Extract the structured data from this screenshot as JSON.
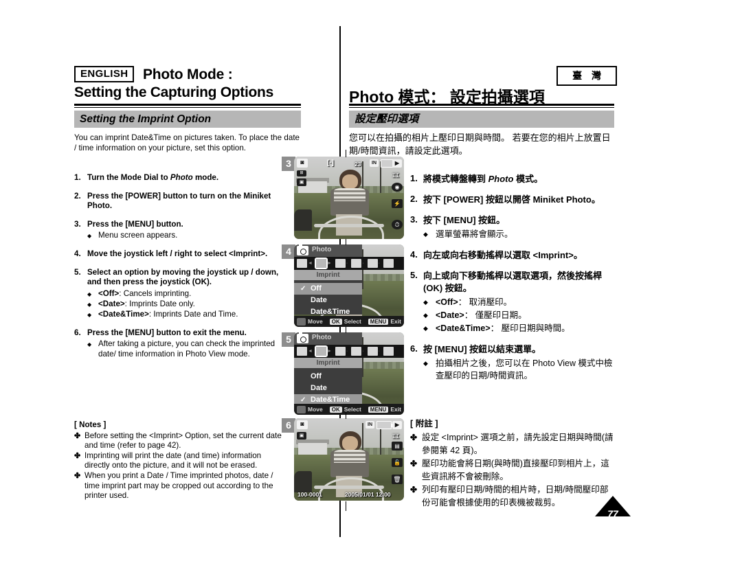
{
  "header": {
    "lang_badge": "ENGLISH",
    "title_line1": "Photo Mode :",
    "title_line2": "Setting the Capturing Options",
    "region_badge": "臺 灣",
    "title_zh": "Photo 模式： 設定拍攝選項"
  },
  "section": {
    "title_en": "Setting the Imprint Option",
    "title_zh": "設定壓印選項"
  },
  "intro": {
    "en": "You can imprint Date&Time on pictures taken. To place the date / time information on your picture, set this option.",
    "zh": "您可以在拍攝的相片上壓印日期與時間。 若要在您的相片上放置日期/時間資訊，請設定此選項。"
  },
  "steps_en": [
    {
      "num": "1.",
      "text_prefix": "Turn the Mode Dial to ",
      "text_italic": "Photo",
      "text_suffix": " mode.",
      "bullets": []
    },
    {
      "num": "2.",
      "text": "Press the [POWER] button to turn on the Miniket Photo.",
      "bullets": []
    },
    {
      "num": "3.",
      "text": "Press the [MENU] button.",
      "bullets": [
        {
          "mark": "◆",
          "text": "Menu screen appears."
        }
      ]
    },
    {
      "num": "4.",
      "text": "Move the joystick left / right to select <Imprint>.",
      "bullets": []
    },
    {
      "num": "5.",
      "text": "Select an option by moving the joystick up / down, and then press the joystick (OK).",
      "bullets": [
        {
          "mark": "◆",
          "bold": "<Off>",
          "text": ": Cancels imprinting."
        },
        {
          "mark": "◆",
          "bold": "<Date>",
          "text": ": Imprints Date only."
        },
        {
          "mark": "◆",
          "bold": "<Date&Time>",
          "text": ": Imprints Date and Time."
        }
      ]
    },
    {
      "num": "6.",
      "text": "Press the [MENU] button to exit the menu.",
      "bullets": [
        {
          "mark": "◆",
          "text": "After taking a picture, you can check the imprinted date/ time information in Photo View mode."
        }
      ]
    }
  ],
  "steps_zh": [
    {
      "num": "1.",
      "text_prefix": "將模式轉盤轉到 ",
      "text_italic": "Photo",
      "text_suffix": " 模式。",
      "bullets": []
    },
    {
      "num": "2.",
      "text": "按下 [POWER] 按鈕以開啓 Miniket Photo。",
      "bullets": []
    },
    {
      "num": "3.",
      "text": "按下 [MENU] 按鈕。",
      "bullets": [
        {
          "mark": "◆",
          "text": "選單螢幕將會顯示。"
        }
      ]
    },
    {
      "num": "4.",
      "text": "向左或向右移動搖桿以選取 <Imprint>。",
      "bullets": []
    },
    {
      "num": "5.",
      "text": "向上或向下移動搖桿以選取選項，然後按搖桿 (OK) 按鈕。",
      "bullets": [
        {
          "mark": "◆",
          "bold": "<Off>",
          "text": "： 取消壓印。"
        },
        {
          "mark": "◆",
          "bold": "<Date>",
          "text": "： 僅壓印日期。"
        },
        {
          "mark": "◆",
          "bold": "<Date&Time>",
          "text": "： 壓印日期與時間。"
        }
      ]
    },
    {
      "num": "6.",
      "text": "按 [MENU] 按鈕以結束選單。",
      "bullets": [
        {
          "mark": "◆",
          "text": "拍攝相片之後，您可以在 Photo View 模式中檢查壓印的日期/時間資訊。"
        }
      ]
    }
  ],
  "notes_en": {
    "title": "[ Notes ]",
    "mark": "✤",
    "items": [
      "Before setting the <Imprint> Option, set the current date and time (refer to page 42).",
      "Imprinting will print the date (and time) information directly onto the picture, and it will not be erased.",
      "When you print a Date / Time imprinted photos, date / time imprint part may be cropped out according to the printer used."
    ]
  },
  "notes_zh": {
    "title": "[ 附註 ]",
    "mark": "✤",
    "items": [
      "設定 <Imprint> 選項之前，請先設定日期與時間(請參閱第 42 頁)。",
      "壓印功能會將日期(與時間)直接壓印到相片上，這些資訊將不會被刪除。",
      "列印有壓印日期/時間的相片時，日期/時間壓印部份可能會根據使用的印表機被裁剪。"
    ]
  },
  "lcds": [
    {
      "step": "3",
      "type": "live",
      "counter": "23",
      "storage": "IN",
      "icons": [
        "play-icon",
        "zoom-icon",
        "red-eye-icon",
        "no-flash-icon",
        "self-timer-icon"
      ]
    },
    {
      "step": "4",
      "type": "menu",
      "title": "Photo",
      "submenu": "Imprint",
      "options": [
        {
          "label": "Off",
          "checked": true,
          "highlighted": true
        },
        {
          "label": "Date",
          "checked": false,
          "highlighted": false
        },
        {
          "label": "Date&Time",
          "checked": false,
          "highlighted": false
        }
      ],
      "bottom": {
        "move": "Move",
        "ok_key": "OK",
        "ok_label": "Select",
        "menu_key": "MENU",
        "menu_label": "Exit"
      }
    },
    {
      "step": "5",
      "type": "menu",
      "title": "Photo",
      "submenu": "Imprint",
      "options": [
        {
          "label": "Off",
          "checked": false,
          "highlighted": false
        },
        {
          "label": "Date",
          "checked": false,
          "highlighted": false
        },
        {
          "label": "Date&Time",
          "checked": true,
          "highlighted": true
        }
      ],
      "bottom": {
        "move": "Move",
        "ok_key": "OK",
        "ok_label": "Select",
        "menu_key": "MENU",
        "menu_label": "Exit"
      }
    },
    {
      "step": "6",
      "type": "view",
      "file_no": "100-0001",
      "timestamp": "2005/01/01 12:00",
      "storage": "IN",
      "icons": [
        "play-icon",
        "zoom-icon",
        "multi-view-icon",
        "lock-icon",
        "delete-icon"
      ]
    }
  ],
  "page_number": "77"
}
